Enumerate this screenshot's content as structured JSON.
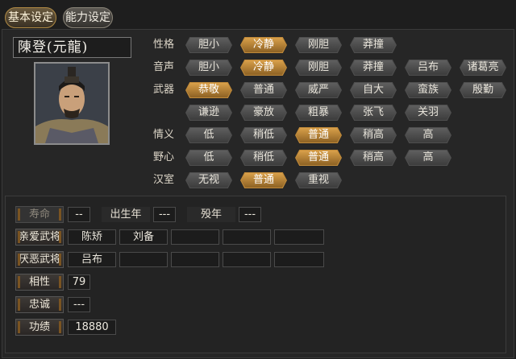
{
  "tabs": [
    "基本设定",
    "能力设定"
  ],
  "character_name": "陳登(元龍)",
  "rows": [
    {
      "label": "性格",
      "options": [
        "胆小",
        "冷静",
        "刚胆",
        "莽撞"
      ],
      "selected": 1
    },
    {
      "label": "音声",
      "options": [
        "胆小",
        "冷静",
        "刚胆",
        "莽撞",
        "吕布",
        "诸葛亮"
      ],
      "selected": 1
    },
    {
      "label": "武器",
      "options": [
        "恭敬",
        "普通",
        "威严",
        "自大",
        "蛮族",
        "殷勤"
      ],
      "selected": 0
    },
    {
      "label": "",
      "options": [
        "谦逊",
        "豪放",
        "粗暴",
        "张飞",
        "关羽"
      ],
      "selected": -1
    },
    {
      "label": "情义",
      "options": [
        "低",
        "稍低",
        "普通",
        "稍高",
        "高"
      ],
      "selected": 2
    },
    {
      "label": "野心",
      "options": [
        "低",
        "稍低",
        "普通",
        "稍高",
        "高"
      ],
      "selected": 2
    },
    {
      "label": "汉室",
      "options": [
        "无视",
        "普通",
        "重视"
      ],
      "selected": 1
    }
  ],
  "lower": {
    "lifespan_label": "寿命",
    "lifespan_value": "--",
    "birth_label": "出生年",
    "birth_value": "---",
    "death_label": "殁年",
    "death_value": "---",
    "favored_label": "亲爱武将",
    "favored": [
      "陈矫",
      "刘备",
      "",
      "",
      ""
    ],
    "hated_label": "厌恶武将",
    "hated": [
      "吕布",
      "",
      "",
      "",
      ""
    ],
    "affinity_label": "相性",
    "affinity_value": "79",
    "loyalty_label": "忠诚",
    "loyalty_value": "---",
    "merit_label": "功绩",
    "merit_value": "18880"
  },
  "colors": {
    "selected": "#c08a3a",
    "option": "#4e4e4e",
    "background": "#1e1e1e"
  }
}
